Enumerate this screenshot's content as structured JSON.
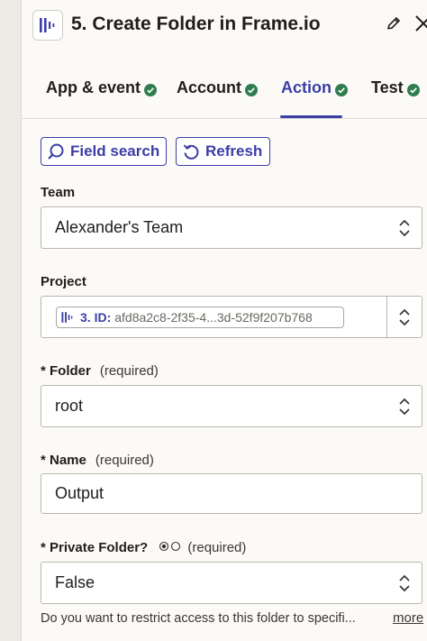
{
  "header": {
    "title": "5. Create Folder in Frame.io"
  },
  "tabs": [
    {
      "label": "App & event",
      "status": "complete",
      "active": false
    },
    {
      "label": "Account",
      "status": "complete",
      "active": false
    },
    {
      "label": "Action",
      "status": "complete",
      "active": true
    },
    {
      "label": "Test",
      "status": "complete",
      "active": false
    }
  ],
  "toolbar": {
    "field_search_label": "Field search",
    "refresh_label": "Refresh"
  },
  "fields": {
    "team": {
      "label": "Team",
      "value": "Alexander's Team"
    },
    "project": {
      "label": "Project",
      "step": "3. ID:",
      "value": "afd8a2c8-2f35-4...3d-52f9f207b768"
    },
    "folder": {
      "label": "* Folder",
      "required": "(required)",
      "value": "root"
    },
    "name": {
      "label": "* Name",
      "required": "(required)",
      "value": "Output"
    },
    "private_folder": {
      "label": "* Private Folder?",
      "required": "(required)",
      "value": "False",
      "help": "Do you want to restrict access to this folder to specifi...",
      "more": "more"
    }
  },
  "colors": {
    "accent": "#3b3ea6",
    "success": "#2f7d4f",
    "background": "#fbfaf7"
  },
  "icons": {
    "app": "frameio-logo-icon",
    "edit": "pencil-icon",
    "close": "close-icon",
    "check": "check-circle-icon",
    "search": "search-icon",
    "refresh": "refresh-icon",
    "updown": "chevron-up-down-icon"
  }
}
